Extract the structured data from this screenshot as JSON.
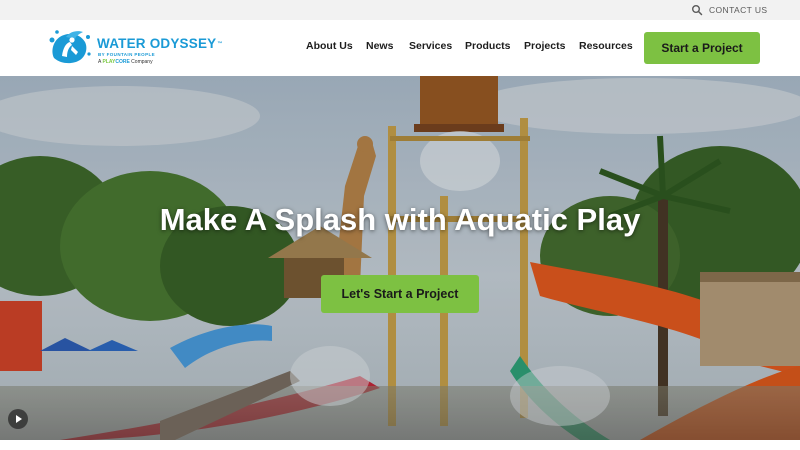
{
  "utility": {
    "search_icon": "search-icon",
    "contact_label": "CONTACT US"
  },
  "logo": {
    "name": "WATER ODYSSEY",
    "trademark": "™",
    "tagline": "BY FOUNTAIN PEOPLE",
    "company_prefix": "A ",
    "company_play": "PLAY",
    "company_core": "CORE",
    "company_suffix": " Company"
  },
  "nav": {
    "items": [
      "About Us",
      "News",
      "Services",
      "Products",
      "Projects",
      "Resources"
    ],
    "cta_label": "Start a Project"
  },
  "hero": {
    "title": "Make A Splash with Aquatic Play",
    "cta_label": "Let's Start a Project",
    "play_icon": "play-icon"
  },
  "colors": {
    "brand_blue": "#1a9ad6",
    "accent_green": "#7dc142",
    "utility_bg": "#f2f2f2"
  }
}
